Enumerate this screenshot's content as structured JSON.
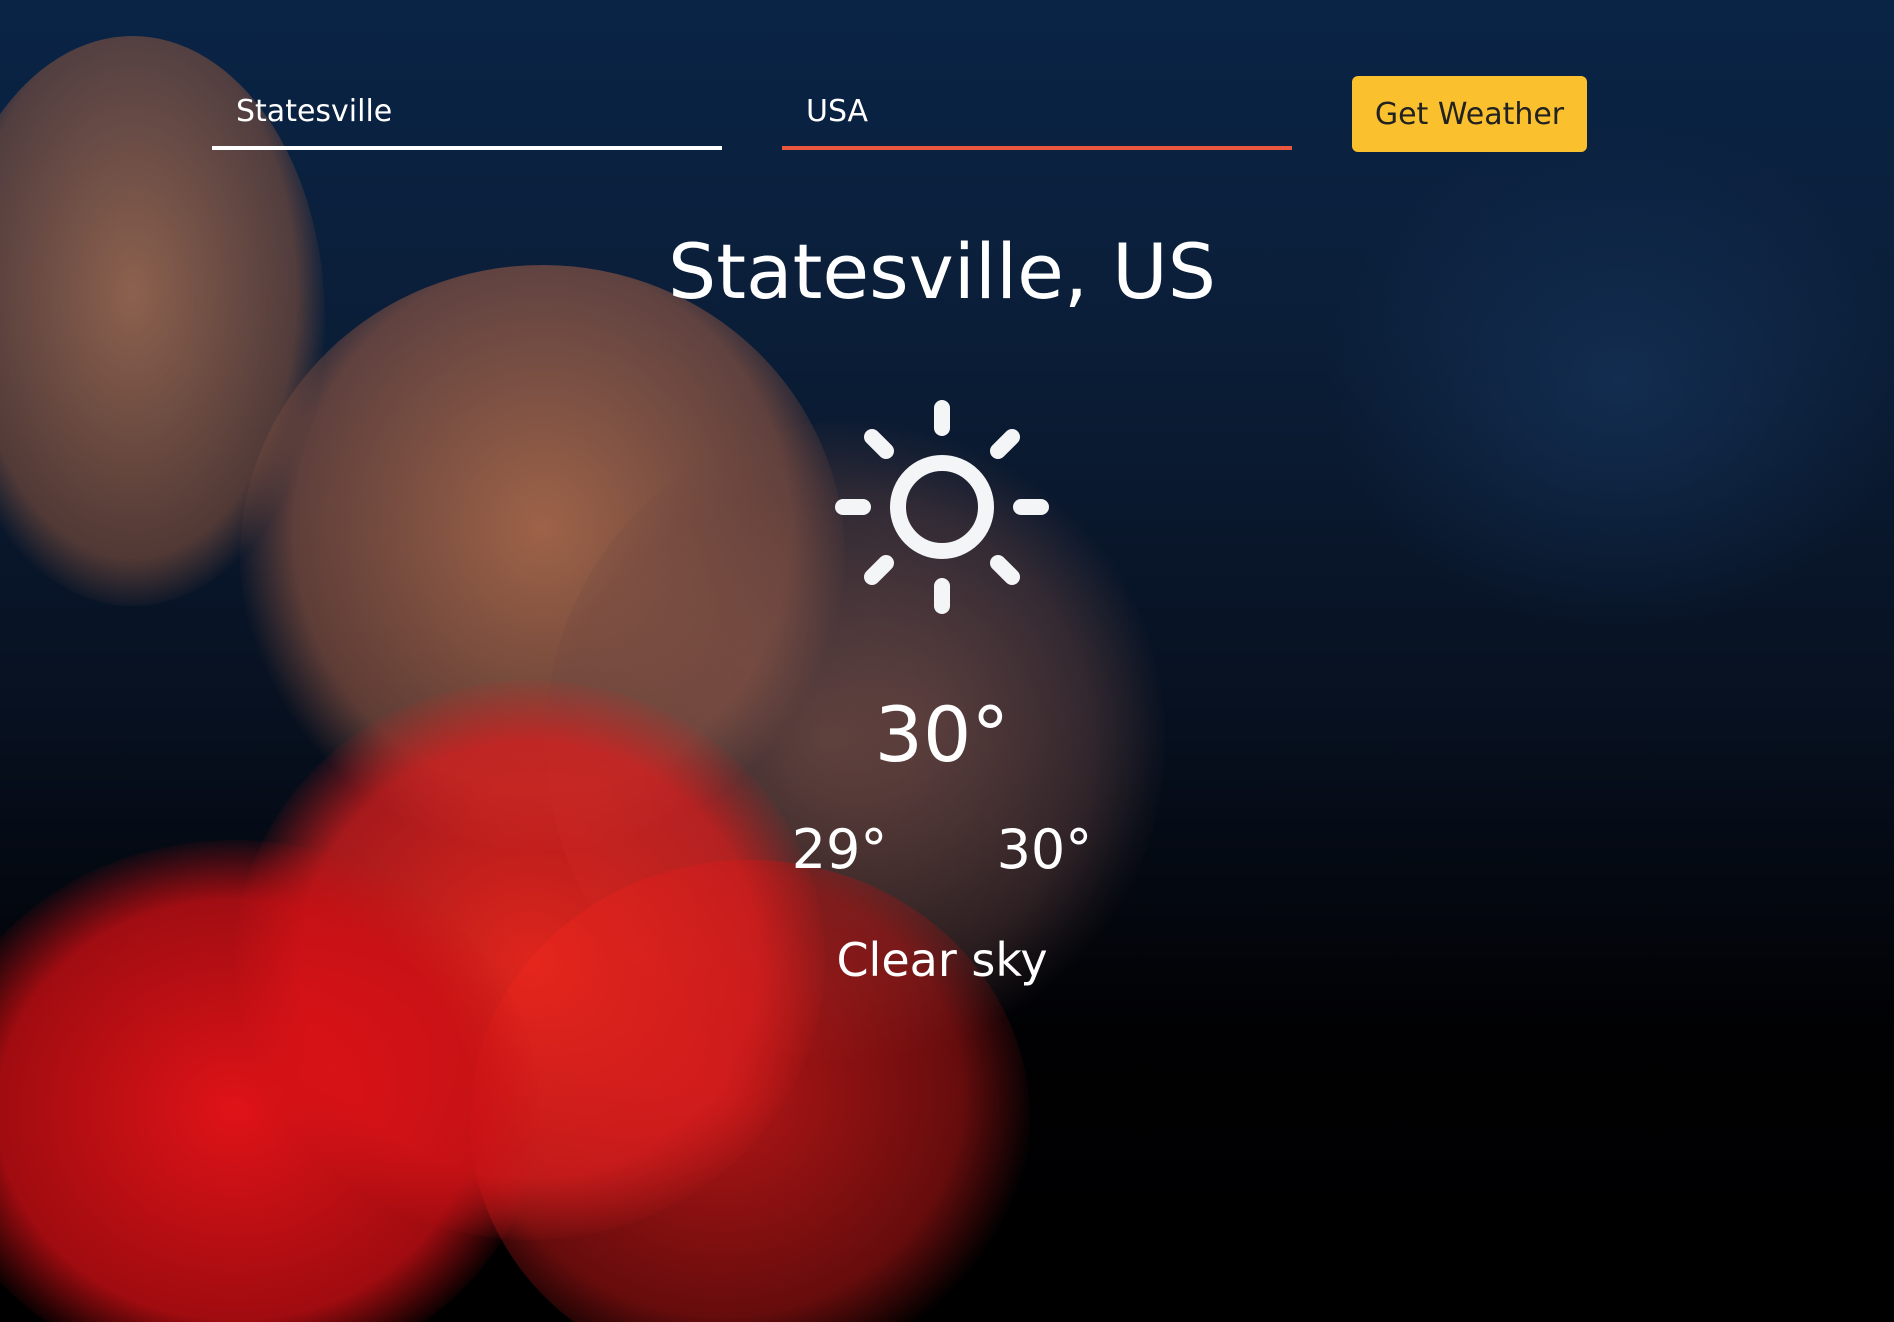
{
  "search": {
    "city_value": "Statesville",
    "country_value": "USA",
    "button_label": "Get Weather"
  },
  "weather": {
    "location": "Statesville, US",
    "icon": "sun-icon",
    "temperature": "30°",
    "min_temperature": "29°",
    "max_temperature": "30°",
    "description": "Clear sky"
  },
  "colors": {
    "button_bg": "#fbc02d",
    "active_underline": "#e9573f",
    "text": "#ffffff"
  }
}
